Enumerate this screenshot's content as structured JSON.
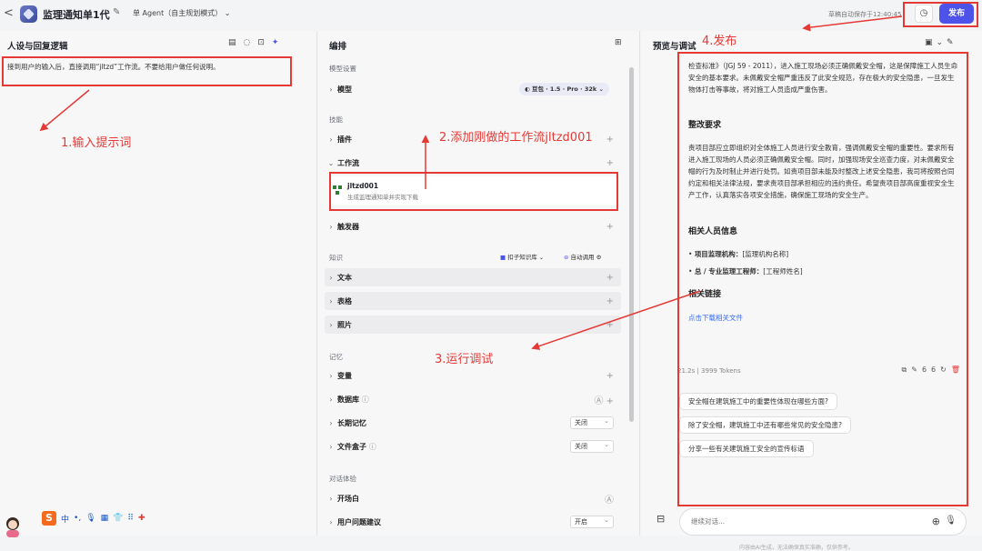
{
  "topbar": {
    "back": "<",
    "title": "监理通知单1代",
    "agent_mode": "单 Agent（自主规划模式）",
    "autosave": "草稿自动保存于12:40:45",
    "publish": "发布"
  },
  "left": {
    "title": "人设与回复逻辑",
    "prompt_text": "接到用户的输入后，直接调用“jltzd”工作流。不要给用户做任何说明。"
  },
  "middle": {
    "title": "编排",
    "model_section": "模型设置",
    "model_label": "模型",
    "model_value": "豆包 · 1.5 · Pro · 32k",
    "skills_section": "技能",
    "plugin_label": "插件",
    "workflow_label": "工作流",
    "workflow_item": {
      "name": "jltzd001",
      "desc": "生成监理通知单并实现下载"
    },
    "trigger_label": "触发器",
    "knowledge_section": "知识",
    "kb_select": "扣子知识库",
    "auto_call": "自动调用",
    "text_label": "文本",
    "table_label": "表格",
    "photo_label": "照片",
    "memory_section": "记忆",
    "var_label": "变量",
    "db_label": "数据库",
    "ltm_label": "长期记忆",
    "ltm_value": "关闭",
    "filebox_label": "文件盒子",
    "filebox_value": "关闭",
    "dialog_section": "对话体验",
    "opening_label": "开场白",
    "suggest_label": "用户问题建议",
    "suggest_value": "开启"
  },
  "right": {
    "title": "预览与调试",
    "para1": "检查标准》（JGJ 59 - 2011），进入施工现场必须正确佩戴安全帽，这是保障施工人员生命安全的基本要求。未佩戴安全帽严重违反了此安全规范，存在极大的安全隐患，一旦发生物体打击等事故，将对施工人员造成严重伤害。",
    "h_rect": "整改要求",
    "para2": "责项目部应立即组织对全体施工人员进行安全教育，强调佩戴安全帽的重要性。要求所有进入施工现场的人员必须正确佩戴安全帽。同时，加强现场安全巡查力度，对未佩戴安全帽的行为及时制止并进行处罚。如责项目部未能及时整改上述安全隐患，我司将按照合同约定和相关法律法规，要求责项目部承担相应的违约责任。希望责项目部高度重视安全生产工作，认真落实各项安全措施，确保施工现场的安全生产。",
    "h_people": "相关人员信息",
    "li1_label": "项目监理机构：",
    "li1_value": "[监理机构名称]",
    "li2_label": "总 / 专业监理工程师：",
    "li2_value": "[工程师姓名]",
    "h_link": "相关链接",
    "link": "点击下载相关文件",
    "tokens": "21.2s | 3999 Tokens",
    "suggestions": [
      "安全帽在建筑施工中的重要性体现在哪些方面?",
      "除了安全帽，建筑施工中还有哪些常见的安全隐患?",
      "分享一些有关建筑施工安全的宣传标语"
    ],
    "input_placeholder": "继续对话...",
    "footer": "内容由AI生成，无法确保真实准确，仅供参考。"
  },
  "annotations": {
    "a1": "1.输入提示词",
    "a2": "2.添加刚做的工作流jltzd001",
    "a3": "3.运行调试",
    "a4": "4.发布"
  },
  "ime": {
    "s": "S",
    "zh": "中"
  },
  "colors": {
    "accent": "#4d53e8",
    "annotation": "#e53935",
    "link": "#3a6cf4"
  }
}
